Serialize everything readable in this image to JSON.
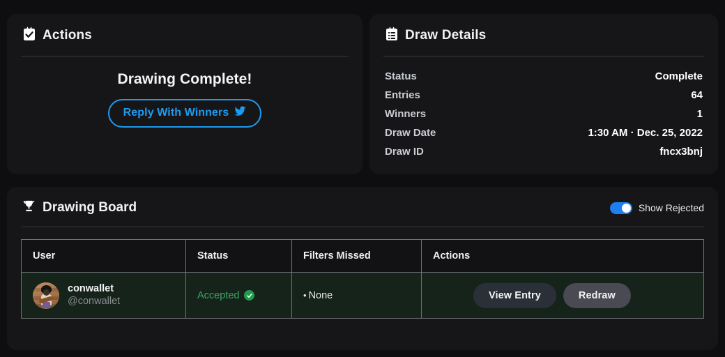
{
  "theme": {
    "background": "#0e0e10",
    "card_bg": "#161618",
    "accent_blue": "#1d9bf0",
    "accent_green": "#3ea664",
    "row_green_bg": "#16231a",
    "border": "#6f7277",
    "text_primary": "#f2f2f3",
    "text_muted": "#8b8d92"
  },
  "actions_card": {
    "icon": "clipboard-check-icon",
    "title": "Actions",
    "headline": "Drawing Complete!",
    "reply_button": {
      "label": "Reply With Winners",
      "icon": "twitter-bird-icon"
    }
  },
  "draw_details_card": {
    "icon": "clipboard-list-icon",
    "title": "Draw Details",
    "rows": [
      {
        "label": "Status",
        "value": "Complete"
      },
      {
        "label": "Entries",
        "value": "64"
      },
      {
        "label": "Winners",
        "value": "1"
      },
      {
        "label": "Draw Date",
        "value": "1:30 AM · Dec. 25, 2022"
      },
      {
        "label": "Draw ID",
        "value": "fncx3bnj"
      }
    ]
  },
  "drawing_board": {
    "icon": "trophy-icon",
    "title": "Drawing Board",
    "toggle": {
      "label": "Show Rejected",
      "checked": true
    },
    "table": {
      "columns": [
        "User",
        "Status",
        "Filters Missed",
        "Actions"
      ],
      "rows": [
        {
          "avatar": "user-avatar-conwallet",
          "name": "conwallet",
          "handle": "@conwallet",
          "status": "Accepted",
          "status_icon": "verified-check-icon",
          "filters_missed": "None",
          "filters_bullet": "•",
          "actions": [
            {
              "label": "View Entry",
              "style": "view"
            },
            {
              "label": "Redraw",
              "style": "redraw"
            }
          ]
        }
      ]
    }
  }
}
